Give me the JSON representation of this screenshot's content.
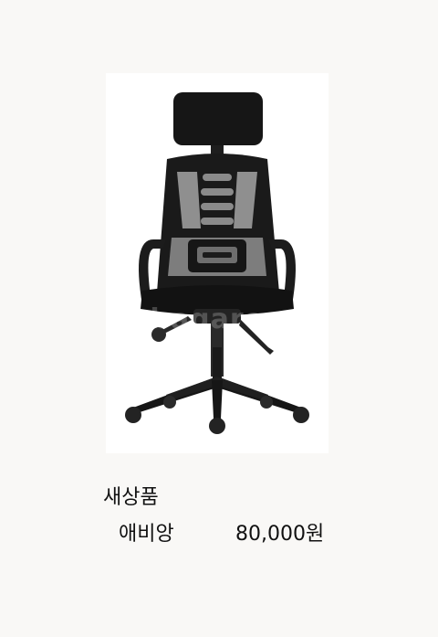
{
  "listing": {
    "image_alt": "black mesh office chair",
    "watermark": "bagaron",
    "condition": "새상품",
    "product_name": "애비앙",
    "price": "80,000원"
  }
}
